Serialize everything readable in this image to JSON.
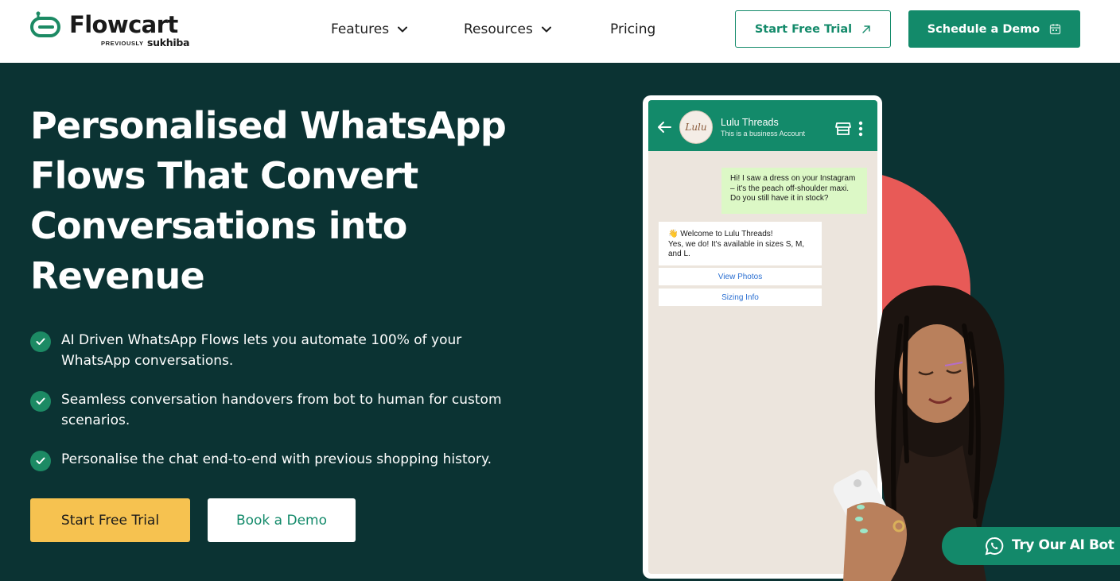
{
  "nav": {
    "logo": {
      "word": "Flowcart",
      "previously": "PREVIOUSLY",
      "sub": "sukhiba"
    },
    "menu": [
      {
        "label": "Features",
        "has_dropdown": true
      },
      {
        "label": "Resources",
        "has_dropdown": true
      },
      {
        "label": "Pricing",
        "has_dropdown": false
      }
    ],
    "trial_label": "Start Free Trial",
    "demo_label": "Schedule a Demo"
  },
  "hero": {
    "title_lines": [
      "Personalised WhatsApp",
      "Flows That Convert",
      "Conversations into",
      "Revenue"
    ],
    "bullets": [
      {
        "line1": "AI Driven WhatsApp Flows lets you automate 100% of your",
        "line2": "WhatsApp conversations."
      },
      {
        "line1": "Seamless conversation handovers from bot to human for custom",
        "line2": "scenarios."
      },
      {
        "line1": "Personalise the chat end-to-end with previous shopping history.",
        "line2": ""
      }
    ],
    "start_label": "Start Free Trial",
    "book_label": "Book a Demo"
  },
  "phone": {
    "contact_name": "Lulu Threads",
    "contact_sub": "This is a business Account",
    "avatar_text": "Lulu",
    "outgoing": [
      "Hi! I saw a dress on your Instagram",
      "– it's the peach off-shoulder maxi.",
      "Do you still have it in stock?"
    ],
    "incoming": [
      "👋 Welcome to Lulu Threads!",
      "Yes, we do! It's available in sizes S, M,",
      "and L."
    ],
    "buttons": [
      "View Photos",
      "Sizing Info"
    ]
  },
  "float": {
    "label": "Try Our AI Bot"
  },
  "colors": {
    "brand": "#138a6a",
    "hero_bg": "#0b3333",
    "cta_yellow": "#f6c250",
    "accent_red": "#e85a57"
  }
}
